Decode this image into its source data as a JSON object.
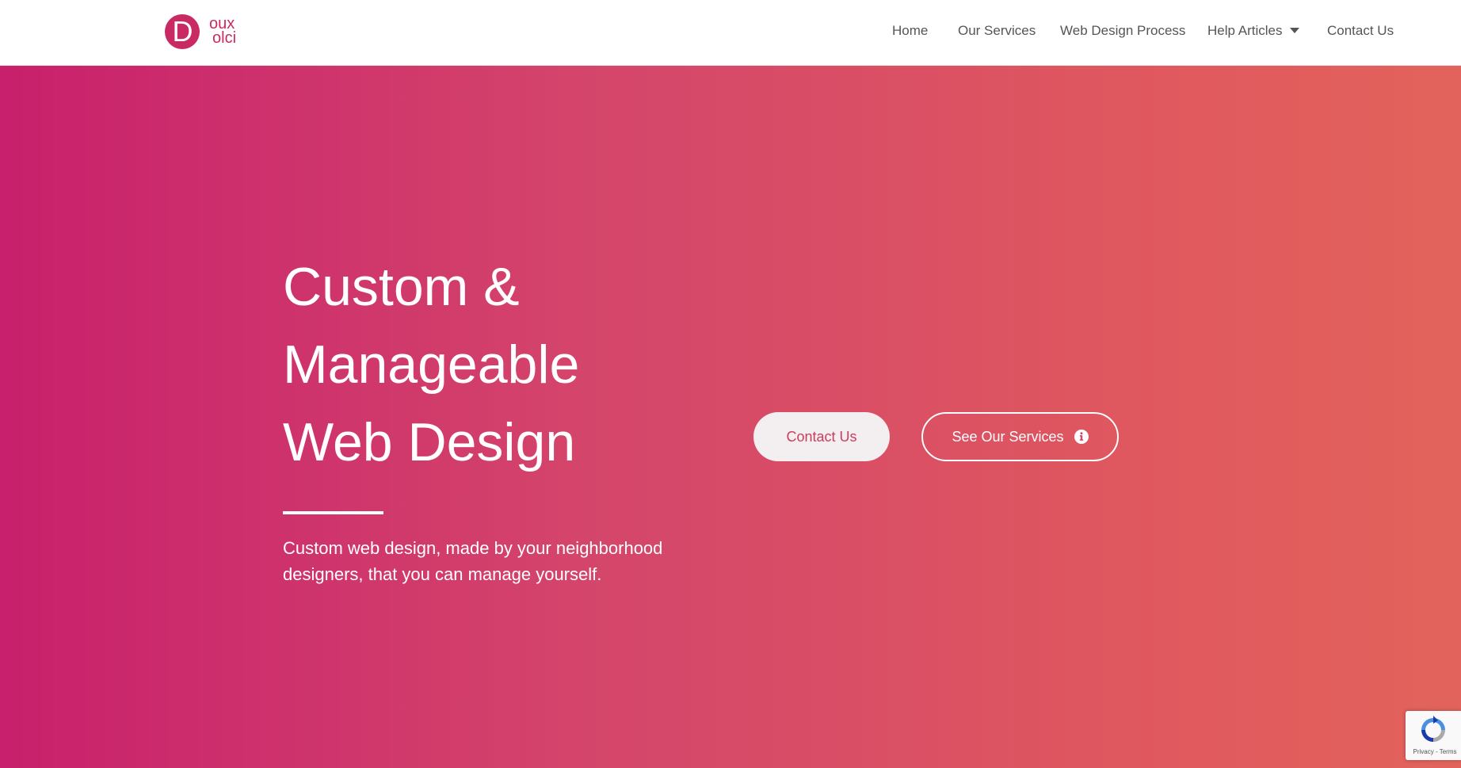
{
  "brand": {
    "logo_initial": "D",
    "logo_line1": "oux",
    "logo_line2": "olci",
    "color": "#c92a63"
  },
  "nav": {
    "items": [
      {
        "label": "Home"
      },
      {
        "label": "Our Services"
      },
      {
        "label": "Web Design Process"
      },
      {
        "label": "Help Articles",
        "has_dropdown": true,
        "icon": "caret-down-icon"
      },
      {
        "label": "Contact Us"
      }
    ]
  },
  "hero": {
    "title_lines": [
      "Custom &",
      "Manageable",
      "Web Design"
    ],
    "subtitle": "Custom web design, made by your neighborhood designers, that you can manage yourself.",
    "primary_button": "Contact Us",
    "secondary_button": "See Our Services",
    "secondary_icon": "info-circle-icon",
    "gradient_start": "#c8206c",
    "gradient_end": "#e2635c"
  },
  "recaptcha": {
    "links": "Privacy - Terms",
    "icon": "recaptcha-icon"
  }
}
